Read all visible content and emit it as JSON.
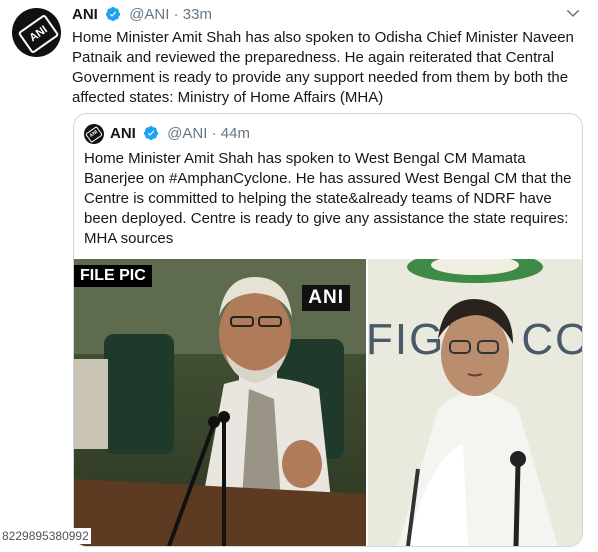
{
  "tweet": {
    "name": "ANI",
    "handle": "@ANI",
    "separator": "·",
    "time": "33m",
    "text": "Home Minister Amit Shah has also spoken to Odisha Chief Minister Naveen Patnaik and reviewed the preparedness. He again reiterated that Central Government is ready to provide any support needed from them by both the affected states: Ministry of Home Affairs (MHA)",
    "avatar_logo": "ANI",
    "verified_icon": "verified-badge-icon",
    "more_icon": "chevron-down-icon"
  },
  "quoted": {
    "name": "ANI",
    "handle": "@ANI",
    "separator": "·",
    "time": "44m",
    "text": "Home Minister Amit Shah has spoken to West Bengal CM Mamata Banerjee on #AmphanCyclone. He has assured West Bengal CM that the Centre is committed to helping the state&already teams of NDRF have been deployed. Centre is ready to give any assistance the state requires: MHA sources",
    "photo_left_caption": "FILE PIC",
    "photo_left_watermark": "ANI",
    "photo_right_banner": "FIGHT CO"
  },
  "overlay": {
    "id_label": "8229895380992"
  },
  "colors": {
    "text": "#14171a",
    "muted": "#657786",
    "verified": "#1da1f2",
    "border": "#ccd6dd"
  }
}
